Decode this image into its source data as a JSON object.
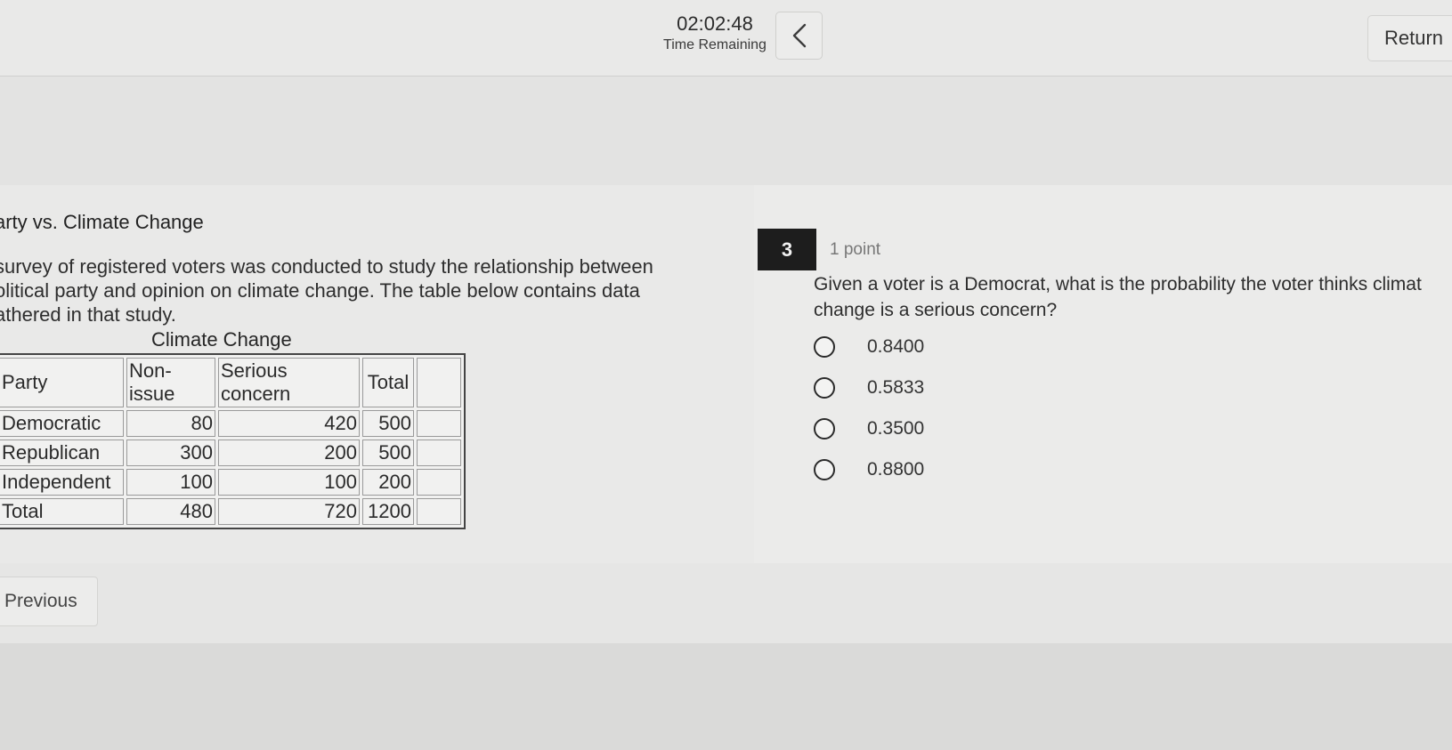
{
  "header": {
    "timer_value": "02:02:48",
    "timer_label": "Time Remaining",
    "collapse_icon": "chevron-left-icon",
    "return_label": "Return"
  },
  "passage": {
    "title": "arty vs. Climate Change",
    "text_lines": [
      "survey of registered voters was conducted to study the relationship between",
      "olitical party and opinion on climate change. The table below contains data",
      "athered in that study."
    ],
    "table": {
      "caption": "Climate Change",
      "headers": [
        "Party",
        "Non-issue",
        "Serious concern",
        "Total",
        ""
      ],
      "rows": [
        [
          "Democratic",
          "80",
          "420",
          "500",
          ""
        ],
        [
          "Republican",
          "300",
          "200",
          "500",
          ""
        ],
        [
          "Independent",
          "100",
          "100",
          "200",
          ""
        ],
        [
          "Total",
          "480",
          "720",
          "1200",
          ""
        ]
      ]
    }
  },
  "question": {
    "number": "3",
    "points": "1 point",
    "text_lines": [
      "Given a voter is a Democrat, what is the probability the voter thinks climat",
      "change is a serious concern?"
    ],
    "options": [
      "0.8400",
      "0.5833",
      "0.3500",
      "0.8800"
    ]
  },
  "footer": {
    "previous_label": "Previous"
  }
}
